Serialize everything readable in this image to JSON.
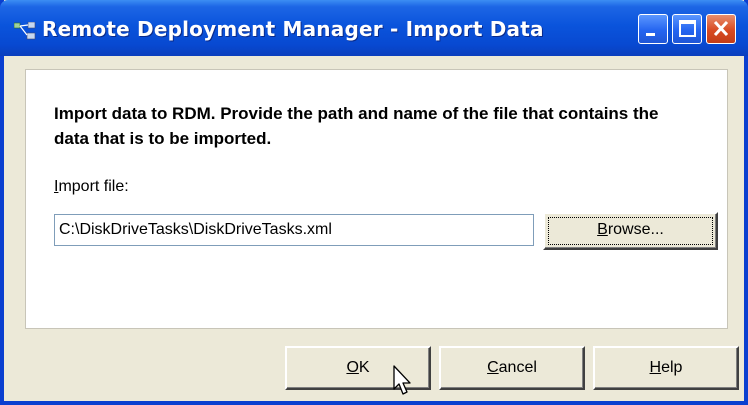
{
  "window": {
    "title": "Remote Deployment Manager - Import Data",
    "controls": [
      "minimize-icon",
      "maximize-icon",
      "close-icon"
    ]
  },
  "content": {
    "intro_text": "Import data to RDM.  Provide the path and name of the file that contains the data that is to be imported.",
    "import_label_first": "I",
    "import_label_rest": "mport file:",
    "import_file_value": "C:\\DiskDriveTasks\\DiskDriveTasks.xml",
    "browse_first": "B",
    "browse_rest": "rowse..."
  },
  "buttons": {
    "ok_first": "O",
    "ok_rest": "K",
    "cancel_first": "C",
    "cancel_rest": "ancel",
    "help_first": "H",
    "help_rest": "elp"
  },
  "colors": {
    "title_bar": "#0a54dc",
    "close_button": "#d84a22",
    "dialog_bg": "#ece9d8"
  }
}
